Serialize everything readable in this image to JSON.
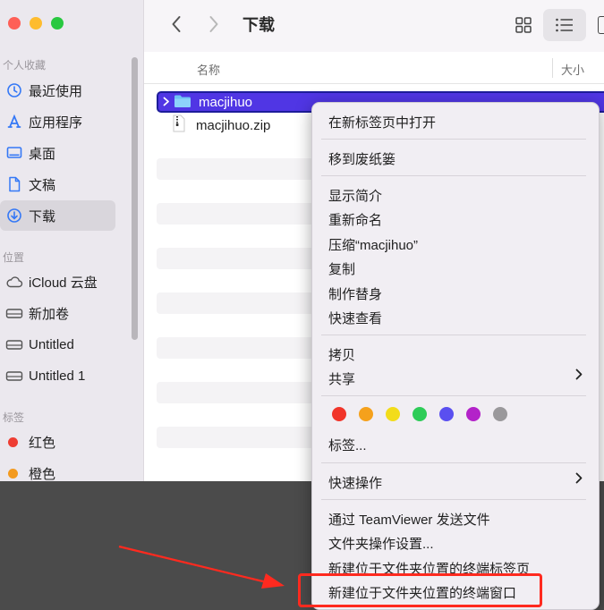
{
  "toolbar": {
    "title": "下载",
    "back": "back",
    "forward": "forward"
  },
  "sidebar": {
    "sections": {
      "favorites": "个人收藏",
      "locations": "位置",
      "tags": "标签"
    },
    "favorites": [
      {
        "label": "最近使用",
        "icon": "clock-icon"
      },
      {
        "label": "应用程序",
        "icon": "apps-icon"
      },
      {
        "label": "桌面",
        "icon": "desktop-icon"
      },
      {
        "label": "文稿",
        "icon": "document-icon"
      },
      {
        "label": "下载",
        "icon": "download-icon",
        "active": true
      }
    ],
    "locations": [
      {
        "label": "iCloud 云盘",
        "icon": "cloud-icon"
      },
      {
        "label": "新加卷",
        "icon": "drive-icon"
      },
      {
        "label": "Untitled",
        "icon": "drive-icon"
      },
      {
        "label": "Untitled 1",
        "icon": "drive-icon"
      }
    ],
    "tags": [
      {
        "label": "红色",
        "color": "#ee3d33"
      },
      {
        "label": "橙色",
        "color": "#f39a1f"
      }
    ]
  },
  "columns": {
    "name": "名称",
    "size": "大小"
  },
  "files": [
    {
      "name": "macjihuo",
      "type": "folder",
      "selected": true
    },
    {
      "name": "macjihuo.zip",
      "type": "zip"
    }
  ],
  "context_menu": {
    "open_new_tab": "在新标签页中打开",
    "move_to_trash": "移到废纸篓",
    "get_info": "显示简介",
    "rename": "重新命名",
    "compress": "压缩“macjihuo”",
    "copy": "复制",
    "make_alias": "制作替身",
    "quick_look": "快速查看",
    "copy2": "拷贝",
    "share": "共享",
    "tag_colors": [
      "#f1352a",
      "#f5a11c",
      "#f2dc1a",
      "#2ecc58",
      "#5a4ff0",
      "#b322c9",
      "#9a989b"
    ],
    "tags": "标签...",
    "quick_actions": "快速操作",
    "teamviewer": "通过 TeamViewer 发送文件",
    "folder_actions": "文件夹操作设置...",
    "new_terminal_tab": "新建位于文件夹位置的终端标签页",
    "new_terminal_window": "新建位于文件夹位置的终端窗口"
  },
  "accent": "#ff2a1f"
}
